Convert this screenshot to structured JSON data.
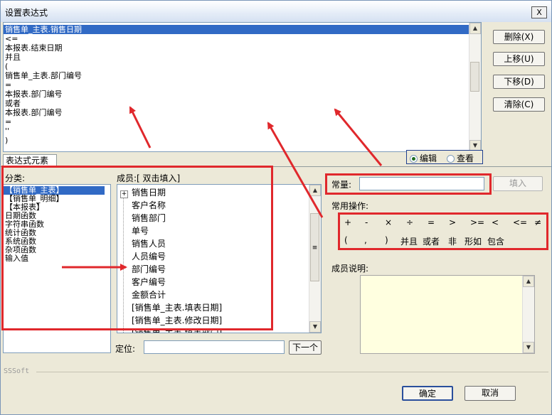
{
  "window": {
    "title": "设置表达式",
    "close_label": "X"
  },
  "expression_lines": [
    "销售单_主表.销售日期",
    "<=",
    "本报表.结束日期",
    "并且",
    "(",
    "销售单_主表.部门编号",
    "=",
    "本报表.部门编号",
    "或者",
    "本报表.部门编号",
    "=",
    "''",
    ")"
  ],
  "side_buttons": {
    "delete": "删除(X)",
    "move_up": "上移(U)",
    "move_down": "下移(D)",
    "clear": "清除(C)"
  },
  "mode": {
    "edit": "编辑",
    "view": "查看",
    "selected": "edit"
  },
  "tab": {
    "label": "表达式元素"
  },
  "category": {
    "label": "分类:",
    "items": [
      "【销售单_主表】",
      "【销售单_明细】",
      "【本报表】",
      "日期函数",
      "字符串函数",
      "统计函数",
      "系统函数",
      "杂项函数",
      "输入值"
    ],
    "selected_index": 0
  },
  "members": {
    "label": "成员:[ 双击填入]",
    "items": [
      "销售日期",
      "客户名称",
      "销售部门",
      "单号",
      "销售人员",
      "人员编号",
      "部门编号",
      "客户编号",
      "金额合计",
      "[销售单_主表.填表日期]",
      "[销售单_主表.修改日期]",
      "[销售单_主表.填表部门]"
    ],
    "expand_glyph": "+"
  },
  "locate": {
    "label": "定位:",
    "value": "",
    "next_button": "下一个"
  },
  "constant": {
    "label": "常量:",
    "value": "",
    "fill_button": "填入"
  },
  "ops": {
    "label": "常用操作:",
    "row1": [
      "+",
      "-",
      "×",
      "÷",
      "=",
      ">",
      ">=",
      "<",
      "<=",
      "≠"
    ],
    "row2": [
      "(",
      ",",
      ")",
      "并且",
      "或者",
      "非",
      "形如",
      "包含"
    ]
  },
  "member_desc": {
    "label": "成员说明:"
  },
  "footer": {
    "brand": "SSSoft",
    "ok_button": "确定",
    "cancel_button": "取消"
  },
  "colors": {
    "selection": "#316ac5",
    "annotation_red": "#e0282c",
    "desc_bg": "#ffffe0"
  }
}
